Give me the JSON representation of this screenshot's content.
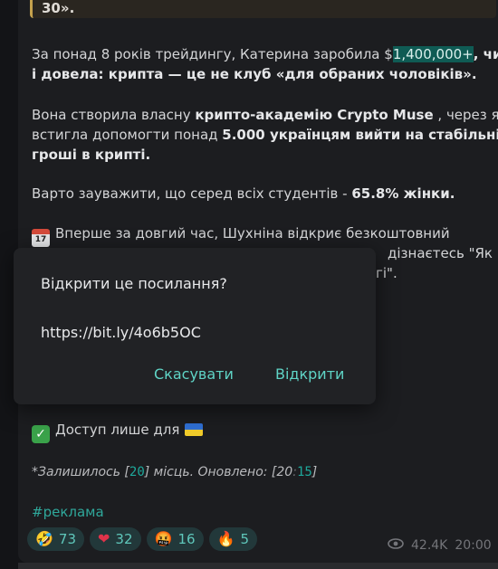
{
  "quote": {
    "text": "30»."
  },
  "paragraphs": {
    "p1_a": "За понад 8 років трейдингу, Катерина заробила $",
    "p1_hl": "1,400,000+",
    "p1_b": ", чим",
    "p1_c": "і довела: крипта — це не клуб «для обраних чоловіків».",
    "p2_a": "Вона створила власну ",
    "p2_bold": "крипто-академію Crypto Muse",
    "p2_b": " , через яку",
    "p2_c": "встигла допомогти понад ",
    "p2_bold2": "5.000 українцям вийти на стабільні",
    "p2_d": "гроші в крипті.",
    "p3_a": "Варто зауважити, що серед всіх студентів - ",
    "p3_bold": "65.8% жінки.",
    "p4_a": "Вперше за довгий час, Шухніна відкриє безкоштовний",
    "p4_b_tail": "дізнаєтесь \"Як",
    "p4_c_tail": "гі\"."
  },
  "calendar_icon_text": "17",
  "dialog": {
    "title": "Відкрити це посилання?",
    "url": "https://bit.ly/4o6b5OC",
    "cancel_label": "Скасувати",
    "open_label": "Відкрити"
  },
  "access": {
    "text": "Доступ лише для"
  },
  "remaining": {
    "prefix": "*Залишилось [",
    "count": "20",
    "middle": "] місць. Оновлено: [20",
    "colon": ":",
    "minutes": "15",
    "suffix": "]"
  },
  "hashtag": "#реклама",
  "reactions": [
    {
      "icon": "rofl-emoji-icon",
      "glyph": "🤣",
      "count": "73"
    },
    {
      "icon": "heart-emoji-icon",
      "glyph": "❤",
      "count": "32"
    },
    {
      "icon": "angry-emoji-icon",
      "glyph": "🤬",
      "count": "16"
    },
    {
      "icon": "fire-emoji-icon",
      "glyph": "🔥",
      "count": "5"
    }
  ],
  "meta": {
    "views": "42.4K",
    "time": "20:00"
  },
  "colors": {
    "accent": "#5fd4c6",
    "highlight": "#0f5b54",
    "reaction_bg": "#22383a"
  }
}
